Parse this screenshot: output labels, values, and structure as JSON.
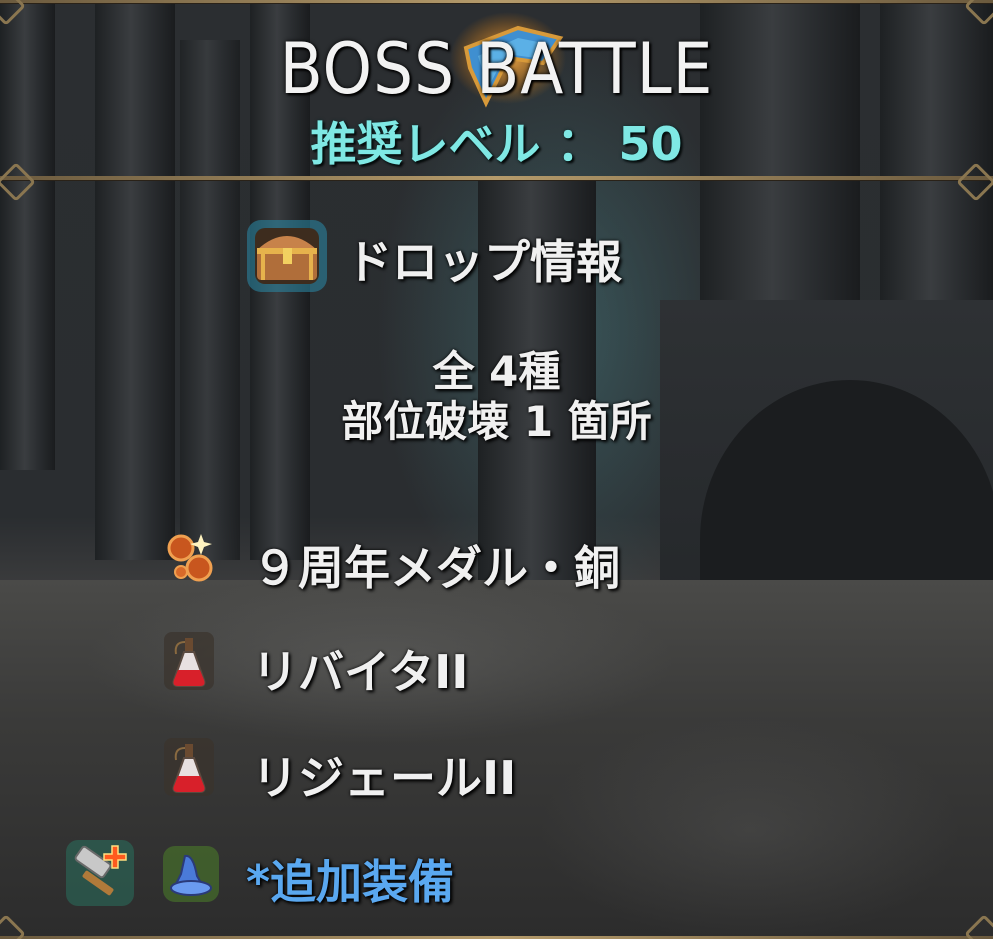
{
  "header": {
    "title": "BOSS BATTLE",
    "recommended_level": "推奨レベル ： 50"
  },
  "drop_info": {
    "label": "ドロップ情報",
    "total": "全 4種",
    "part_break": "部位破壊 1 箇所"
  },
  "drops": [
    {
      "name": "９周年メダル・銅",
      "icon": "bronze-medal-icon"
    },
    {
      "name": "リバイタII",
      "icon": "potion-flask-icon"
    },
    {
      "name": "リジェールII",
      "icon": "potion-flask-icon"
    }
  ],
  "extra_equipment": {
    "label": "*追加装備",
    "icons": [
      "hammer-plus-icon",
      "wizard-hat-icon"
    ]
  },
  "colors": {
    "recommended_level": "#7fe8e4",
    "extra_equipment": "#5aa8f0",
    "frame_gold": "#b59b6b"
  }
}
